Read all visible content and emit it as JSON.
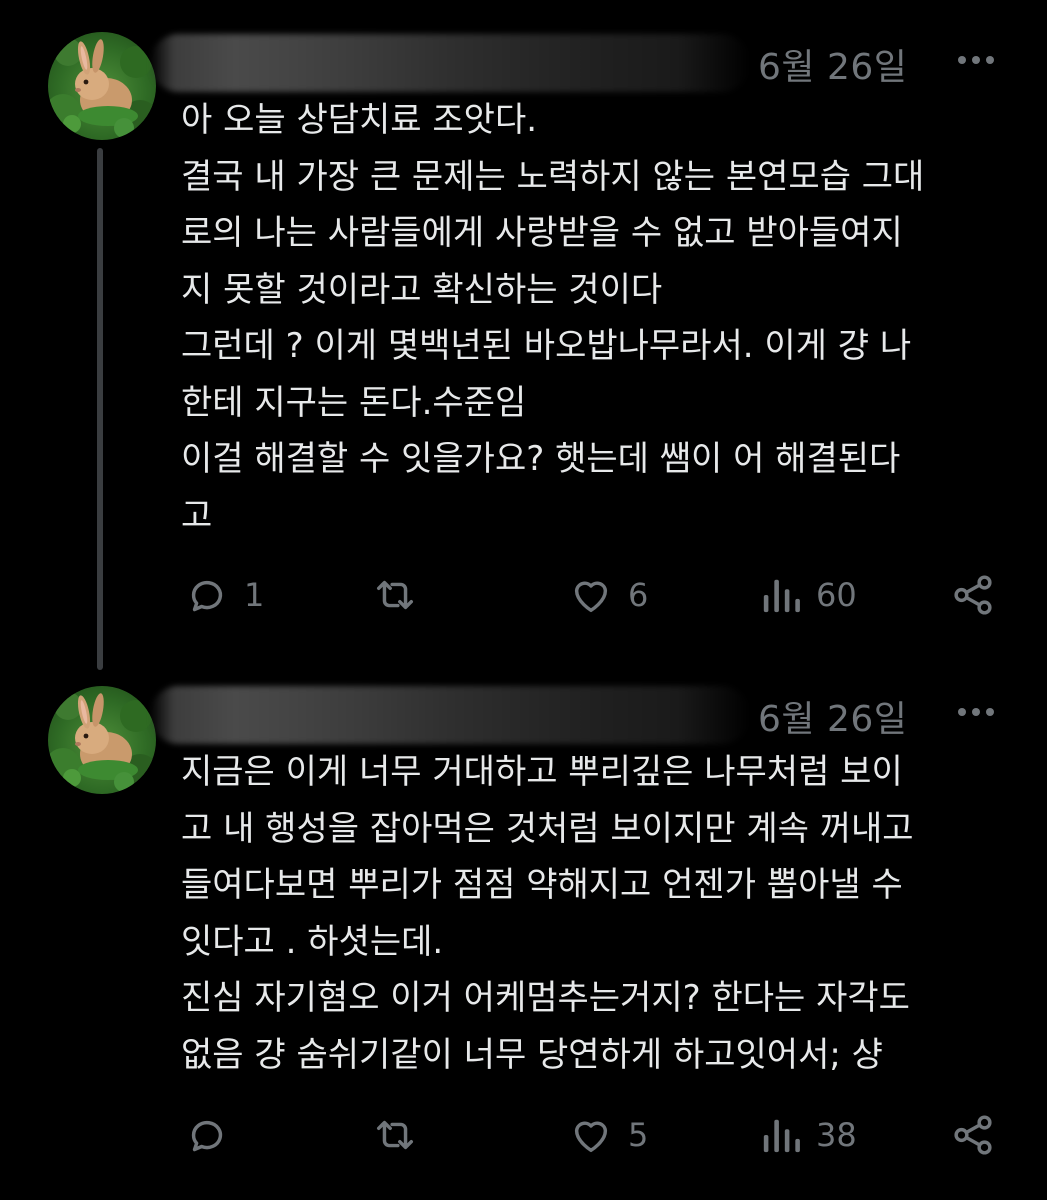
{
  "posts": [
    {
      "date": "6월 26일",
      "lines": [
        "아 오늘 상담치료 조앗다.",
        "결국 내 가장 큰 문제는 노력하지 않는 본연모습 그대",
        "로의 나는 사람들에게 사랑받을 수 없고 받아들여지",
        "지 못할 것이라고 확신하는 것이다",
        "그런데 ? 이게 몇백년된 바오밥나무라서. 이게 걍 나",
        "한테 지구는 돈다.수준임",
        "이걸 해결할 수 잇을가요? 햇는데 쌤이 어 해결된다",
        "고"
      ],
      "reply_count": "1",
      "repost_count": "",
      "like_count": "6",
      "view_count": "60"
    },
    {
      "date": "6월 26일",
      "lines": [
        "지금은 이게 너무 거대하고 뿌리깊은 나무처럼 보이",
        "고 내 행성을 잡아먹은 것처럼 보이지만 계속 꺼내고",
        "들여다보면 뿌리가 점점 약해지고 언젠가 뽑아낼 수",
        "잇다고 . 하셧는데.",
        "진심 자기혐오 이거 어케멈추는거지? 한다는 자각도",
        "없음 걍 숨쉬기같이 너무 당연하게 하고잇어서; 샹"
      ],
      "reply_count": "",
      "repost_count": "",
      "like_count": "5",
      "view_count": "38"
    }
  ],
  "icons": {
    "avatar": "rabbit-avatar",
    "more": "more-dots-icon",
    "reply": "reply-bubble-icon",
    "repost": "repost-arrows-icon",
    "like": "heart-icon",
    "views": "views-bars-icon",
    "share": "share-icon"
  },
  "colors": {
    "background": "#000000",
    "text": "#e7e9ea",
    "muted": "#71767b",
    "thread_line": "#3a3d40"
  }
}
